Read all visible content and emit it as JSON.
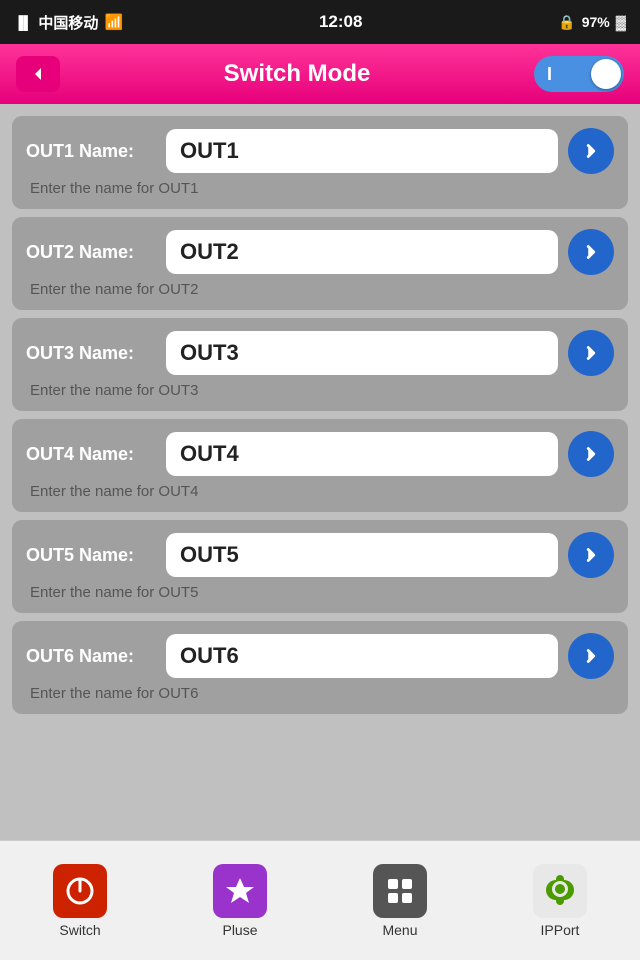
{
  "statusBar": {
    "carrier": "中国移动",
    "time": "12:08",
    "battery": "97%"
  },
  "header": {
    "title": "Switch Mode",
    "backLabel": "←",
    "toggleLabel": "I"
  },
  "outputs": [
    {
      "id": "out1",
      "label": "OUT1 Name:",
      "value": "OUT1",
      "hint": "Enter the name for OUT1"
    },
    {
      "id": "out2",
      "label": "OUT2 Name:",
      "value": "OUT2",
      "hint": "Enter the name for OUT2"
    },
    {
      "id": "out3",
      "label": "OUT3 Name:",
      "value": "OUT3",
      "hint": "Enter the name for OUT3"
    },
    {
      "id": "out4",
      "label": "OUT4 Name:",
      "value": "OUT4",
      "hint": "Enter the name for OUT4"
    },
    {
      "id": "out5",
      "label": "OUT5 Name:",
      "value": "OUT5",
      "hint": "Enter the name for OUT5"
    },
    {
      "id": "out6",
      "label": "OUT6 Name:",
      "value": "OUT6",
      "hint": "Enter the name for OUT6"
    }
  ],
  "tabs": [
    {
      "id": "switch",
      "label": "Switch",
      "iconType": "power"
    },
    {
      "id": "pluse",
      "label": "Pluse",
      "iconType": "star"
    },
    {
      "id": "menu",
      "label": "Menu",
      "iconType": "grid"
    },
    {
      "id": "ipport",
      "label": "IPPort",
      "iconType": "gear"
    }
  ]
}
